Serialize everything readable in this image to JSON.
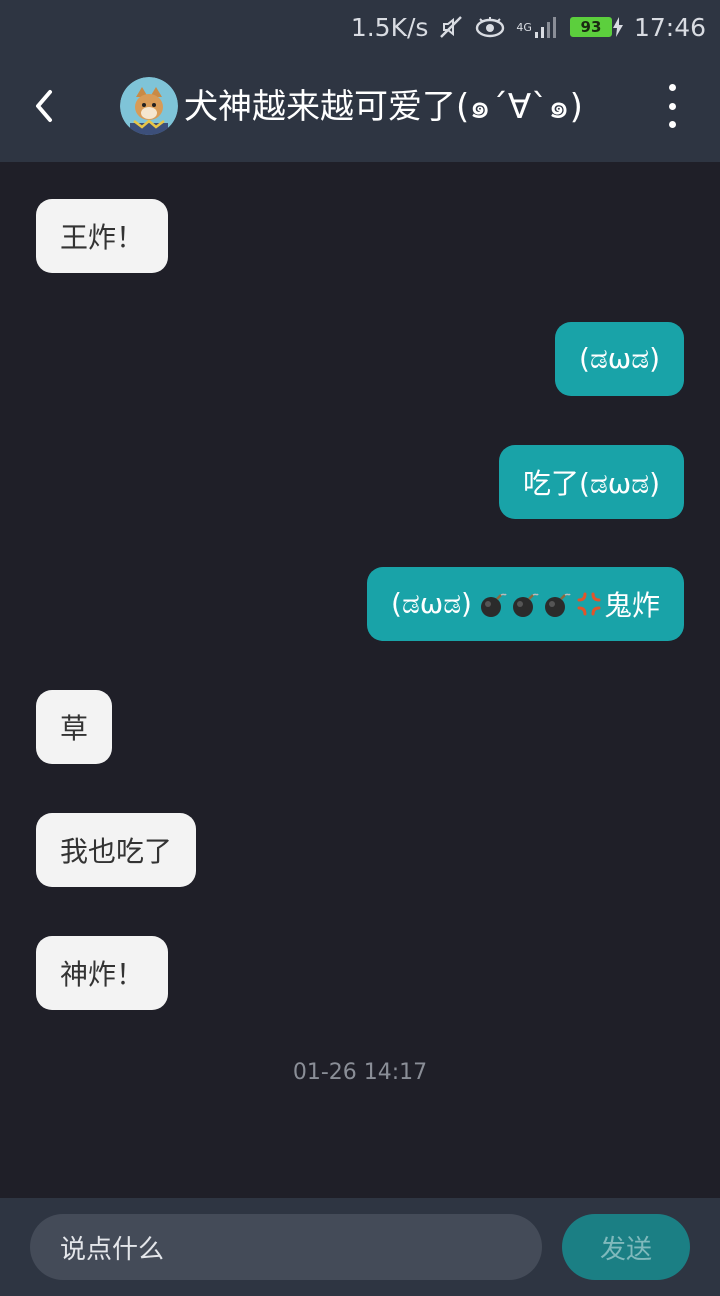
{
  "status_bar": {
    "network_speed": "1.5K/s",
    "network_type": "4G",
    "battery_level": "93",
    "time": "17:46"
  },
  "header": {
    "title": "犬神越来越可爱了(๑´∀`๑)"
  },
  "messages": [
    {
      "side": "incoming",
      "text": "王炸！"
    },
    {
      "side": "outgoing",
      "text": "(ಡωಡ)"
    },
    {
      "side": "outgoing",
      "text": "吃了(ಡωಡ)"
    },
    {
      "side": "outgoing",
      "text_prefix": "(ಡωಡ) ",
      "text_suffix": "鬼炸",
      "emoji_icons": [
        "bomb-icon",
        "bomb-icon",
        "bomb-icon",
        "anger-icon"
      ]
    },
    {
      "side": "incoming",
      "text": "草"
    },
    {
      "side": "incoming",
      "text": "我也吃了"
    },
    {
      "side": "incoming",
      "text": "神炸！"
    }
  ],
  "timestamp": "01-26 14:17",
  "input_bar": {
    "placeholder": "说点什么",
    "send_label": "发送"
  },
  "colors": {
    "background": "#1f1f28",
    "header": "#2e3542",
    "outgoing_bubble": "#19a3a8",
    "incoming_bubble": "#f3f3f3",
    "send_button": "#1b7f84"
  }
}
